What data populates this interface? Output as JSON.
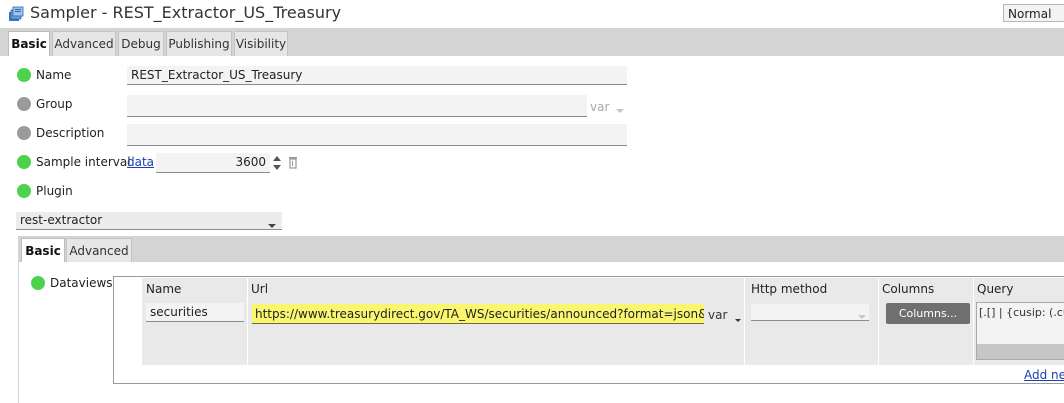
{
  "window": {
    "title": "Sampler - REST_Extractor_US_Treasury",
    "mode": "Normal"
  },
  "tabs": [
    "Basic",
    "Advanced",
    "Debug",
    "Publishing",
    "Visibility"
  ],
  "fields": {
    "name": {
      "label": "Name",
      "value": "REST_Extractor_US_Treasury"
    },
    "group": {
      "label": "Group",
      "value": "",
      "var": "var"
    },
    "description": {
      "label": "Description",
      "value": ""
    },
    "sample_interval": {
      "label": "Sample interval",
      "link": "data",
      "value": "3600"
    },
    "plugin": {
      "label": "Plugin",
      "value": "rest-extractor"
    }
  },
  "inner_tabs": [
    "Basic",
    "Advanced"
  ],
  "dataviews": {
    "label": "Dataviews",
    "columns": [
      "Name",
      "Url",
      "Http method",
      "Columns",
      "Query"
    ],
    "row": {
      "name": "securities",
      "url": "https://www.treasurydirect.gov/TA_WS/securities/announced?format=json&days",
      "url_var": "var",
      "http_method": "",
      "columns_button": "Columns...",
      "query": "[.[] | {cusip: (.cus"
    },
    "add_new": "Add nev"
  },
  "colors": {
    "status_green": "#4ed24e",
    "status_grey": "#9a9a9a",
    "highlight": "#fbf66f",
    "link": "#1a3fb0"
  }
}
